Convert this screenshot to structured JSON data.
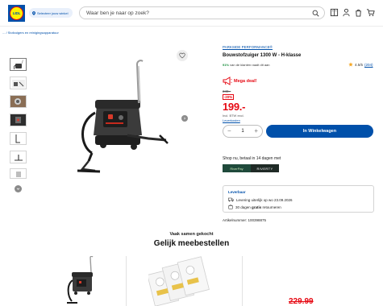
{
  "header": {
    "logo_text": "LIDL",
    "store_button_label": "Selecteer jouw winkel",
    "search_placeholder": "Waar ben je naar op zoek?"
  },
  "breadcrumb": {
    "text": "... / Stofzuigers en reinigingsapparatuur"
  },
  "product": {
    "brand": "PARKSIDE PERFORMANCE®",
    "title": "Bouwstofzuiger 1300 W - H-klasse",
    "recommend_pct": "91%",
    "recommend_text": "van de klanten raadt dit aan",
    "rating_value": "4.5/5",
    "rating_count": "(204)",
    "rating_color": "#f5a623"
  },
  "pricing": {
    "deal_label": "Mega deal!",
    "old_price": "249.-",
    "discount": "-20%",
    "price": "199.-",
    "vat_note": "Incl. BTW excl.",
    "delivery_costs_link": "Leverkosten"
  },
  "cart": {
    "quantity": "1",
    "minus": "−",
    "plus": "+",
    "button_label": "In Winkelwagen"
  },
  "payment": {
    "text": "Shop nu, betaal in 14 dagen met",
    "logo_left": "RiverPay",
    "logo_right": "RIVERTY"
  },
  "delivery": {
    "heading": "Leverbaar",
    "line1": "Levering uiterlijk op wo 23.09.2026",
    "line2_pre": "30 dagen ",
    "line2_bold": "gratis",
    "line2_post": " retourneren"
  },
  "article": {
    "text": "Artikelnummer: 100398875"
  },
  "recommend_section": {
    "subtitle": "Vaak samen gekocht",
    "title": "Gelijk meebestellen",
    "bottom_price": "229.99"
  },
  "colors": {
    "brand_blue": "#0050aa",
    "accent_red": "#e60a14",
    "logo_yellow": "#fff200"
  }
}
